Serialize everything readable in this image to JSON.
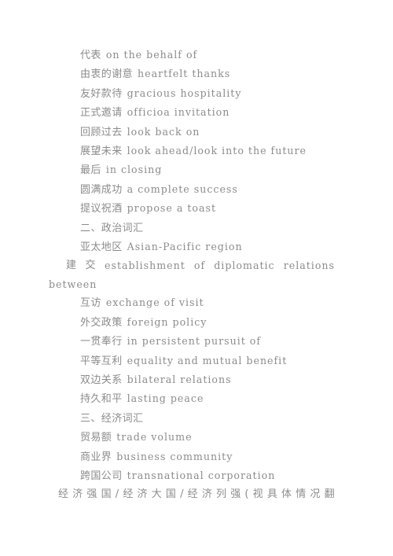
{
  "document": {
    "page_background": "#ffffff",
    "text_color": "#8c8c8c",
    "lines": [
      {
        "id": "l01",
        "cjk": "代表",
        "en": "on the behalf of",
        "style": "indent"
      },
      {
        "id": "l02",
        "cjk": "由衷的谢意",
        "en": "heartfelt thanks",
        "style": "indent"
      },
      {
        "id": "l03",
        "cjk": "友好款待",
        "en": "gracious hospitality",
        "style": "indent"
      },
      {
        "id": "l04",
        "cjk": "正式邀请",
        "en": "officioa invitation",
        "style": "indent"
      },
      {
        "id": "l05",
        "cjk": "回顾过去",
        "en": "look back on",
        "style": "indent"
      },
      {
        "id": "l06",
        "cjk": "展望未来",
        "en": "look ahead/look into the future",
        "style": "indent"
      },
      {
        "id": "l07",
        "cjk": "最后",
        "en": "in closing",
        "style": "indent"
      },
      {
        "id": "l08",
        "cjk": "圆满成功",
        "en": "a complete success",
        "style": "indent"
      },
      {
        "id": "l09",
        "cjk": "提议祝酒",
        "en": "propose a toast",
        "style": "indent"
      },
      {
        "id": "l10",
        "cjk": "二、政治词汇",
        "en": "",
        "style": "heading"
      },
      {
        "id": "l11",
        "cjk": "亚太地区",
        "en": "Asian-Pacific region",
        "style": "indent"
      },
      {
        "id": "l12",
        "cjk": "建交",
        "en": "establishment of diplomatic relations",
        "style": "justified"
      },
      {
        "id": "l13",
        "cjk": "",
        "en": "between",
        "style": "flush"
      },
      {
        "id": "l14",
        "cjk": "互访",
        "en": "exchange of visit",
        "style": "indent"
      },
      {
        "id": "l15",
        "cjk": "外交政策",
        "en": "foreign policy",
        "style": "indent"
      },
      {
        "id": "l16",
        "cjk": "一贯奉行",
        "en": "in persistent pursuit of",
        "style": "indent"
      },
      {
        "id": "l17",
        "cjk": "平等互利",
        "en": "equality and mutual benefit",
        "style": "indent"
      },
      {
        "id": "l18",
        "cjk": "双边关系",
        "en": "bilateral relations",
        "style": "indent"
      },
      {
        "id": "l19",
        "cjk": "持久和平",
        "en": "lasting peace",
        "style": "indent"
      },
      {
        "id": "l20",
        "cjk": "三、经济词汇",
        "en": "",
        "style": "heading"
      },
      {
        "id": "l21",
        "cjk": "贸易额",
        "en": "trade volume",
        "style": "indent"
      },
      {
        "id": "l22",
        "cjk": "商业界",
        "en": "business community",
        "style": "indent"
      },
      {
        "id": "l23",
        "cjk": "跨国公司",
        "en": "transnational corporation",
        "style": "indent"
      },
      {
        "id": "l24",
        "cjk": "经济强国/经济大国/经济列强(视具体情况翻",
        "en": "",
        "style": "justified-cjk"
      }
    ],
    "justified_line_12": {
      "cjk_chars": [
        "建",
        "交"
      ],
      "en_words": [
        "establishment",
        "of",
        "diplomatic",
        "relations"
      ]
    },
    "justified_line_24": {
      "chars": [
        "经",
        "济",
        "强",
        "国",
        "/",
        "经",
        "济",
        "大",
        "国",
        "/",
        "经",
        "济",
        "列",
        "强",
        "(",
        "视",
        "具",
        "体",
        "情",
        "况",
        "翻"
      ]
    }
  }
}
